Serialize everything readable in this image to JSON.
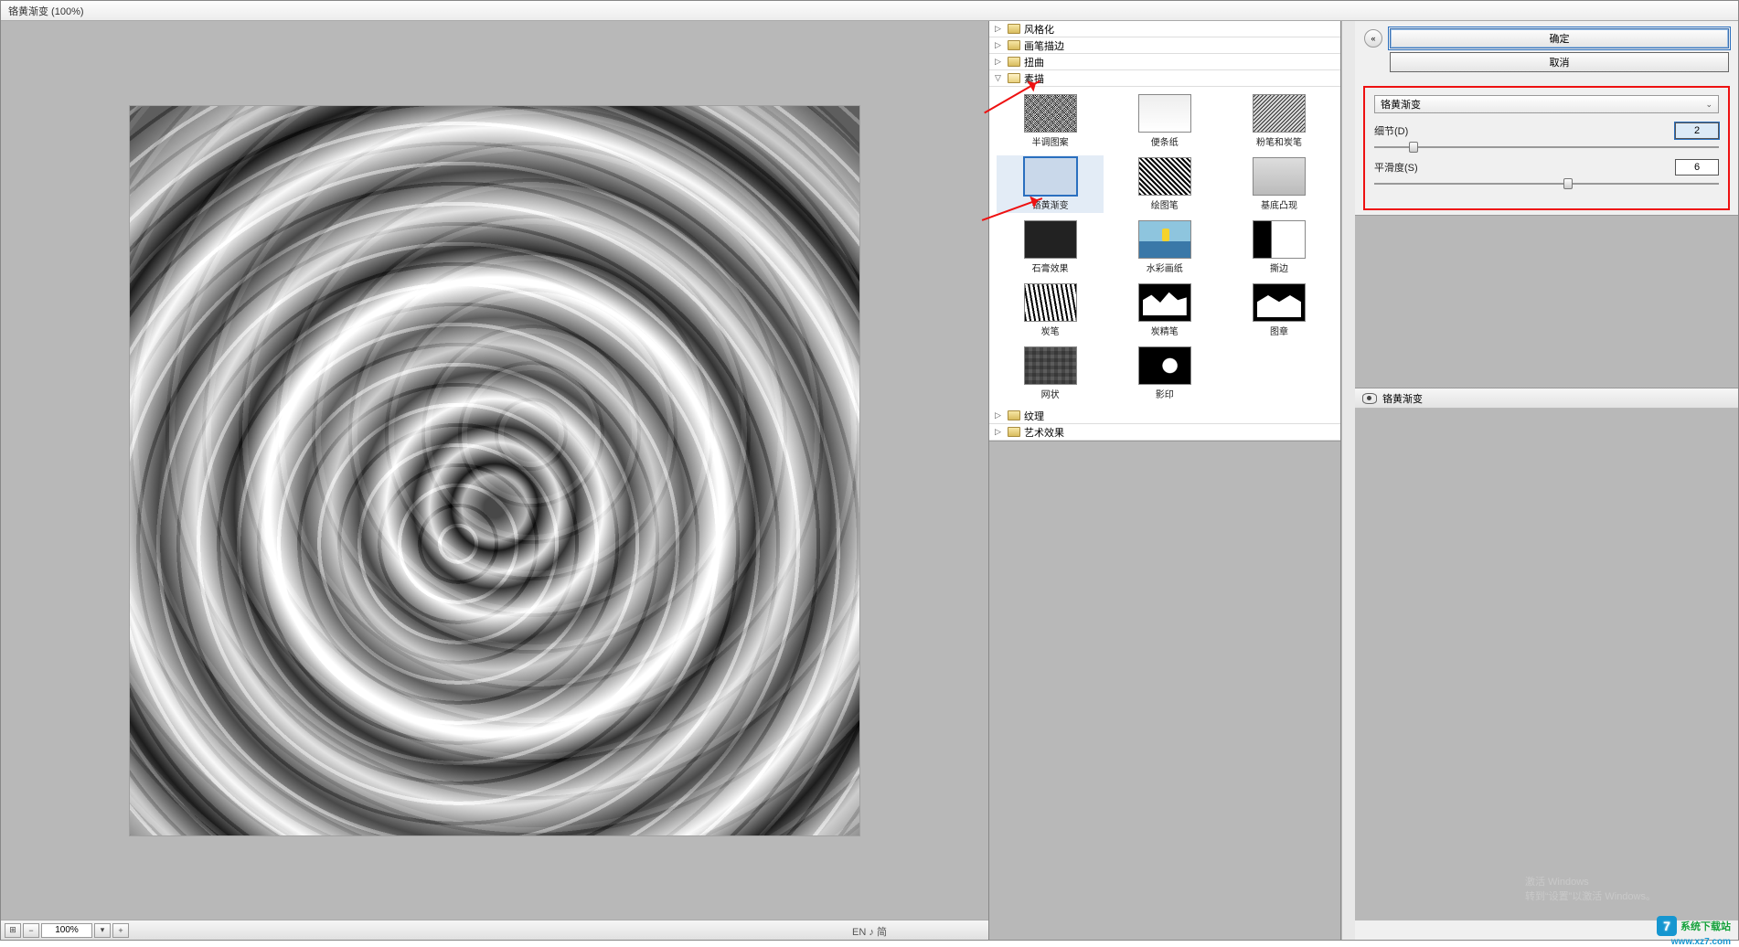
{
  "title": "铬黄渐变 (100%)",
  "zoom": {
    "value": "100%"
  },
  "categories": [
    {
      "name": "风格化",
      "open": false
    },
    {
      "name": "画笔描边",
      "open": false
    },
    {
      "name": "扭曲",
      "open": false
    },
    {
      "name": "素描",
      "open": true
    },
    {
      "name": "纹理",
      "open": false
    },
    {
      "name": "艺术效果",
      "open": false
    }
  ],
  "thumbs": [
    {
      "label": "半调图案",
      "cls": "t-halftone"
    },
    {
      "label": "便条纸",
      "cls": "t-paper"
    },
    {
      "label": "粉笔和炭笔",
      "cls": "t-chalk"
    },
    {
      "label": "铬黄渐变",
      "cls": "t-chrome",
      "selected": true
    },
    {
      "label": "绘图笔",
      "cls": "t-graphic"
    },
    {
      "label": "基底凸现",
      "cls": "t-bas"
    },
    {
      "label": "石膏效果",
      "cls": "t-plaster"
    },
    {
      "label": "水彩画纸",
      "cls": "t-water"
    },
    {
      "label": "撕边",
      "cls": "t-torn"
    },
    {
      "label": "炭笔",
      "cls": "t-charcoal"
    },
    {
      "label": "炭精笔",
      "cls": "t-conte"
    },
    {
      "label": "图章",
      "cls": "t-stamp"
    },
    {
      "label": "网状",
      "cls": "t-ret"
    },
    {
      "label": "影印",
      "cls": "t-photocopy"
    }
  ],
  "buttons": {
    "ok": "确定",
    "cancel": "取消"
  },
  "preset": {
    "label": "铬黄渐变"
  },
  "params": {
    "detail": {
      "label": "细节(D)",
      "value": "2",
      "pos": 10
    },
    "smooth": {
      "label": "平滑度(S)",
      "value": "6",
      "pos": 55
    }
  },
  "layer": {
    "name": "铬黄渐变"
  },
  "watermark": {
    "text": "系统下载站",
    "url": "www.xz7.com",
    "logo": "7"
  },
  "activate": {
    "l1": "激活 Windows",
    "l2": "转到“设置”以激活 Windows。"
  },
  "ime": {
    "text": "EN ♪ 简"
  }
}
